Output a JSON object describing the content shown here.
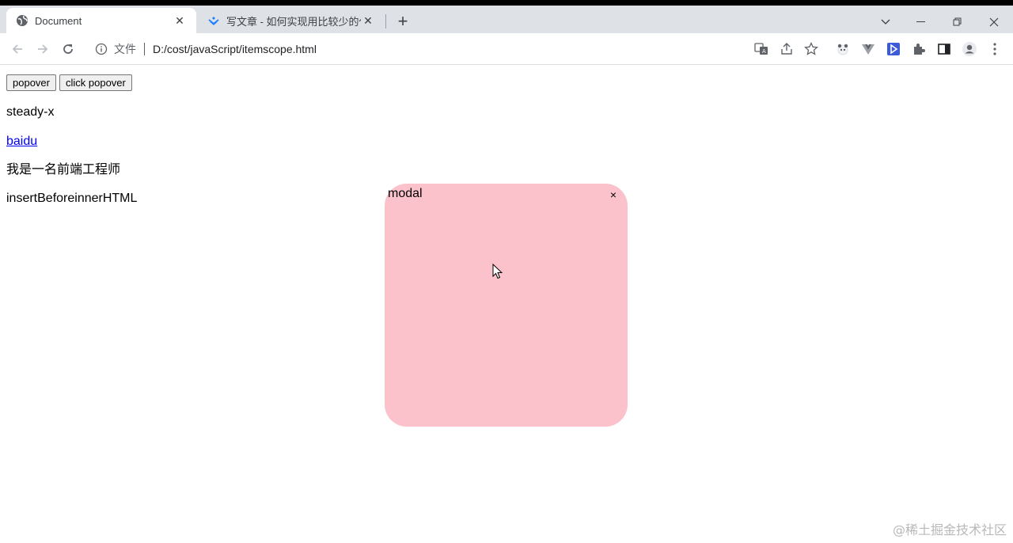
{
  "browser": {
    "tabs": [
      {
        "title": "Document",
        "active": true,
        "favicon": "globe-icon"
      },
      {
        "title": "写文章 - 如何实现用比较少的代",
        "active": false,
        "favicon": "juejin-icon"
      }
    ],
    "url": {
      "scheme_label": "文件",
      "path": "D:/cost/javaScript/itemscope.html"
    }
  },
  "page": {
    "buttons": [
      "popover",
      "click popover"
    ],
    "paragraphs": [
      "steady-x",
      "baidu",
      "我是一名前端工程师",
      "insertBeforeinnerHTML"
    ],
    "modal": {
      "title": "modal",
      "close_label": "×",
      "background": "#fbc2cb"
    }
  },
  "watermark": "@稀土掘金技术社区"
}
